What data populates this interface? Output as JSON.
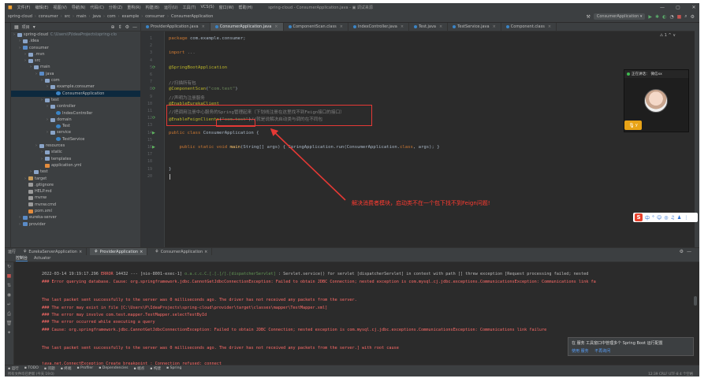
{
  "menubar": {
    "items": [
      "文件(F)",
      "编辑(E)",
      "视图(V)",
      "导航(N)",
      "代码(C)",
      "分析(Z)",
      "重构(R)",
      "构建(B)",
      "运行(U)",
      "工具(T)",
      "VCS(S)",
      "窗口(W)",
      "帮助(H)"
    ],
    "title": "spring-cloud - ConsumerApplication.java - ▣ 调试来源"
  },
  "navbar": {
    "crumbs": [
      "spring-cloud",
      "consumer",
      "src",
      "main",
      "java",
      "com",
      "example",
      "consumer",
      "ConsumerApplication"
    ],
    "run_config": "ConsumerApplication"
  },
  "project": {
    "toolbar_label": "项目",
    "tree": [
      {
        "label": "spring-cloud",
        "dim": "C:\\Users\\P\\IdeaProjects\\spring-clo",
        "indent": 0,
        "icon": "fold"
      },
      {
        "label": ".idea",
        "indent": 1,
        "icon": "fold"
      },
      {
        "label": "consumer",
        "indent": 1,
        "icon": "fold-src"
      },
      {
        "label": ".mvn",
        "indent": 2,
        "icon": "fold"
      },
      {
        "label": "src",
        "indent": 2,
        "icon": "fold"
      },
      {
        "label": "main",
        "indent": 3,
        "icon": "fold"
      },
      {
        "label": "java",
        "indent": 4,
        "icon": "fold-src"
      },
      {
        "label": "com",
        "indent": 5,
        "icon": "fold"
      },
      {
        "label": "example.consumer",
        "indent": 6,
        "icon": "fold"
      },
      {
        "label": "ConsumerApplication",
        "indent": 7,
        "icon": "jcls",
        "selected": true
      },
      {
        "label": "test",
        "indent": 5,
        "icon": "fold"
      },
      {
        "label": "controller",
        "indent": 6,
        "icon": "fold"
      },
      {
        "label": "IndexController",
        "indent": 7,
        "icon": "jcls"
      },
      {
        "label": "domain",
        "indent": 6,
        "icon": "fold"
      },
      {
        "label": "Test",
        "indent": 7,
        "icon": "jcls"
      },
      {
        "label": "service",
        "indent": 6,
        "icon": "fold"
      },
      {
        "label": "TestService",
        "indent": 7,
        "icon": "jcls"
      },
      {
        "label": "resources",
        "indent": 4,
        "icon": "fold"
      },
      {
        "label": "static",
        "indent": 5,
        "icon": "fold"
      },
      {
        "label": "templates",
        "indent": 5,
        "icon": "fold"
      },
      {
        "label": "application.yml",
        "indent": 5,
        "icon": "xml"
      },
      {
        "label": "test",
        "indent": 3,
        "icon": "fold"
      },
      {
        "label": "target",
        "indent": 2,
        "icon": "fold-ex"
      },
      {
        "label": ".gitignore",
        "indent": 2,
        "icon": "txt"
      },
      {
        "label": "HELP.md",
        "indent": 2,
        "icon": "txt"
      },
      {
        "label": "mvnw",
        "indent": 2,
        "icon": "txt"
      },
      {
        "label": "mvnw.cmd",
        "indent": 2,
        "icon": "txt"
      },
      {
        "label": "pom.xml",
        "indent": 2,
        "icon": "xml"
      },
      {
        "label": "eureka-server",
        "indent": 1,
        "icon": "fold-src"
      },
      {
        "label": "provider",
        "indent": 1,
        "icon": "fold-src"
      }
    ]
  },
  "tabs": [
    {
      "label": "ProviderApplication.java",
      "active": false
    },
    {
      "label": "ConsumerApplication.java",
      "active": true
    },
    {
      "label": "ComponentScan.class",
      "active": false
    },
    {
      "label": "IndexController.java",
      "active": false
    },
    {
      "label": "Test.java",
      "active": false
    },
    {
      "label": "TestService.java",
      "active": false
    },
    {
      "label": "Component.class",
      "active": false
    }
  ],
  "editor": {
    "warning_badge": "⚠ 1 ^ ∨",
    "lines": [
      {
        "n": "1",
        "code": [
          [
            "kw",
            "package "
          ],
          [
            "",
            "com.example.consumer;"
          ]
        ]
      },
      {
        "n": "2",
        "code": []
      },
      {
        "n": "3",
        "code": [
          [
            "kw",
            "import "
          ],
          [
            "cmt",
            "..."
          ]
        ]
      },
      {
        "n": "4",
        "code": []
      },
      {
        "n": "5",
        "code": [
          [
            "ann",
            "@SpringBootApplication"
          ]
        ]
      },
      {
        "n": "6",
        "code": []
      },
      {
        "n": "7",
        "code": [
          [
            "cmt",
            "//扫描所有包"
          ]
        ]
      },
      {
        "n": "8",
        "code": [
          [
            "ann",
            "@ComponentScan"
          ],
          [
            "",
            "("
          ],
          [
            "str",
            "\"com.test\""
          ],
          [
            "",
            ")"
          ]
        ]
      },
      {
        "n": "9",
        "code": [
          [
            "cmt",
            "//声明为注册服务"
          ]
        ]
      },
      {
        "n": "10",
        "code": [
          [
            "ann",
            "@EnableEurekaClient"
          ]
        ]
      },
      {
        "n": "11",
        "code": [
          [
            "cmt",
            "//把调用注册中心服务的Spring管理起来（下划线注册在这里找不到Feign接口的接口）"
          ]
        ]
      },
      {
        "n": "12",
        "code": [
          [
            "ann",
            "@EnableFeignClients"
          ],
          [
            "",
            "("
          ],
          [
            "str",
            "\"com.test\""
          ],
          [
            "",
            ")"
          ],
          [
            "cmt",
            "//就是说解决启动类与调的在不同包"
          ]
        ]
      },
      {
        "n": "13",
        "code": []
      },
      {
        "n": "14",
        "code": [
          [
            "kw",
            "public class "
          ],
          [
            "",
            "ConsumerApplication {"
          ]
        ]
      },
      {
        "n": "15",
        "code": []
      },
      {
        "n": "16",
        "code": [
          [
            "",
            "    "
          ],
          [
            "kw",
            "public static void "
          ],
          [
            "fn",
            "main"
          ],
          [
            "",
            "(String[] args) { SpringApplication."
          ],
          [
            "",
            "run"
          ],
          [
            "",
            "(ConsumerApplication."
          ],
          [
            "kw",
            "class"
          ],
          [
            "",
            ", args); }"
          ]
        ]
      },
      {
        "n": "17",
        "code": []
      },
      {
        "n": "18",
        "code": []
      },
      {
        "n": "19",
        "code": [
          [
            "",
            "}"
          ]
        ]
      },
      {
        "n": "20",
        "code": []
      }
    ]
  },
  "annotation": "解决消费者模块，启动类不在一个包下找不到Feign问题!",
  "meeting": {
    "status": "正在讲话：",
    "speaker": "微信xx",
    "name_tag": "y"
  },
  "ime": {
    "logo": "S",
    "icons": [
      "中",
      "°",
      "☺",
      "◎",
      "♫",
      "♟",
      "⋮"
    ]
  },
  "run": {
    "header_label": "运行",
    "tabs": [
      {
        "label": "EurekaServerApplication",
        "active": false
      },
      {
        "label": "ProviderApplication",
        "active": true
      },
      {
        "label": "ConsumerApplication",
        "active": false
      }
    ],
    "subtabs": [
      "控制台",
      "Actuator"
    ],
    "lines": [
      {
        "parts": [
          [
            "",
            "2022-03-14 19:19:17.296 "
          ],
          [
            "lvl",
            "ERROR"
          ],
          [
            "",
            " 14432 --- [nio-8001-exec-1] "
          ],
          [
            "grn",
            "o.a.c.c.C.[.[.[/].[dispatcherServlet]"
          ],
          [
            "",
            " : Servlet.service() for servlet [dispatcherServlet] in context with path [] threw exception [Request processing failed; nested"
          ]
        ]
      },
      {
        "parts": [
          [
            "err",
            "### Error querying database.  Cause: org.springframework.jdbc.CannotGetJdbcConnectionException: Failed to obtain JDBC Connection; nested exception is com.mysql.cj.jdbc.exceptions.CommunicationsException: Communications link fa"
          ]
        ]
      },
      {
        "parts": []
      },
      {
        "parts": [
          [
            "err",
            "The last packet sent successfully to the server was 0 milliseconds ago. The driver has not received any packets from the server."
          ]
        ]
      },
      {
        "parts": [
          [
            "err",
            "### The error may exist in file [C:\\Users\\P\\IdeaProjects\\spring-cloud\\provider\\target\\classes\\mapper\\TestMapper.xml]"
          ]
        ]
      },
      {
        "parts": [
          [
            "err",
            "### The error may involve com.test.mapper.TestMapper.selectTestById"
          ]
        ]
      },
      {
        "parts": [
          [
            "err",
            "### The error occurred while executing a query"
          ]
        ]
      },
      {
        "parts": [
          [
            "err",
            "### Cause: org.springframework.jdbc.CannotGetJdbcConnectionException: Failed to obtain JDBC Connection; nested exception is com.mysql.cj.jdbc.exceptions.CommunicationsException: Communications link failure"
          ]
        ]
      },
      {
        "parts": []
      },
      {
        "parts": [
          [
            "err",
            "The last packet sent successfully to the server was 0 milliseconds ago. The driver has not received any packets from the server.] with root cause"
          ]
        ]
      },
      {
        "parts": []
      },
      {
        "parts": [
          [
            "err",
            "java.net.ConnectException Create breakpoint : Connection refused: connect"
          ]
        ]
      }
    ]
  },
  "notification": {
    "text": "在 服务 工具窗口中管理多个 Spring Boot 运行配置",
    "action1": "使用 服务",
    "action2": "不再询问"
  },
  "bottom_tools": [
    "运行",
    "TODO",
    "问题",
    "终端",
    "Profiler",
    "Dependencies",
    "端点",
    "构建",
    "Spring"
  ],
  "status": {
    "left": "所有文件均已更新 (今天 19:0)",
    "right": "12:39   CRLF   UTF-8   4 个空格"
  }
}
